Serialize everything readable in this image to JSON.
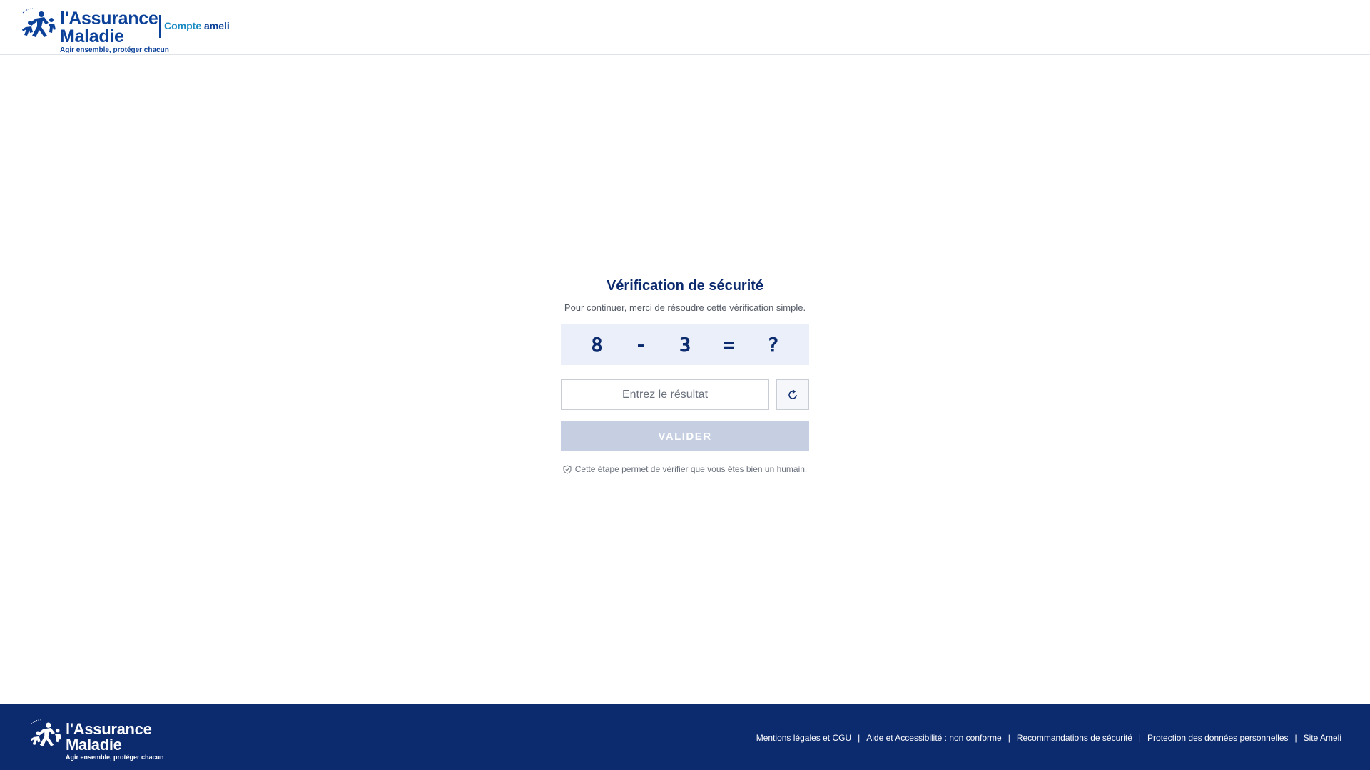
{
  "header": {
    "logo": {
      "line1": "l'Assurance",
      "line2": "Maladie",
      "tagline": "Agir ensemble, protéger chacun"
    },
    "compte_prefix": "Compte",
    "compte_brand": "ameli"
  },
  "main": {
    "title": "Vérification de sécurité",
    "subtitle": "Pour continuer, merci de résoudre cette vérification simple.",
    "captcha": "8 - 3 = ?",
    "input_placeholder": "Entrez le résultat",
    "input_value": "",
    "refresh_icon": "refresh-icon",
    "submit_label": "VALIDER",
    "note_icon": "shield-check-icon",
    "note": "Cette étape permet de vérifier que vous êtes bien un humain."
  },
  "footer": {
    "logo": {
      "line1": "l'Assurance",
      "line2": "Maladie",
      "tagline": "Agir ensemble, protéger chacun"
    },
    "links": [
      "Mentions légales et CGU",
      "Aide et Accessibilité : non conforme",
      "Recommandations de sécurité",
      "Protection des données personnelles",
      "Site Ameli"
    ],
    "separator": "|"
  },
  "colors": {
    "brand_blue": "#0c419a",
    "footer_bg": "#0c2a6e",
    "title": "#0c2a6e",
    "captcha_bg": "#eaeff9",
    "button_disabled": "#c6cfe2",
    "accent_light_blue": "#1a8bc2"
  }
}
